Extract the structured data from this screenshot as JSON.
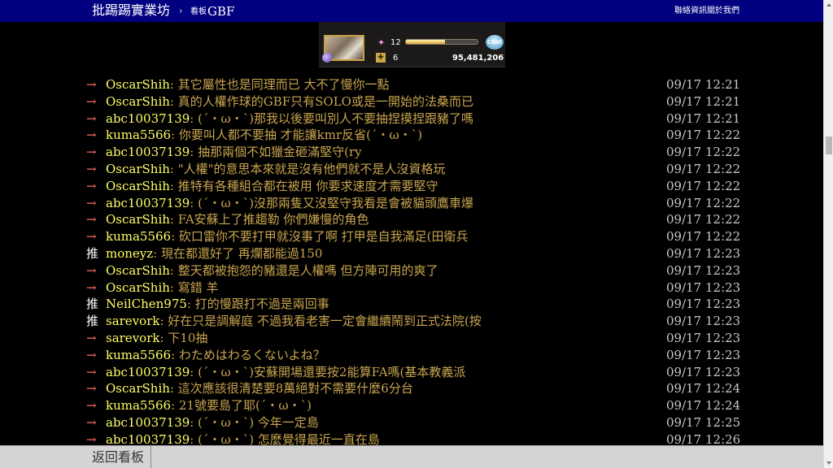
{
  "header": {
    "site_title": "批踢踢實業坊",
    "breadcrumb_sep": "›",
    "board_label": "看板",
    "board_name": "GBF",
    "links": [
      "聯絡資訊",
      "關於我們"
    ]
  },
  "game_image": {
    "stat1": "12",
    "stat2": "6",
    "bar_fill": 0.55,
    "chat": "Chat",
    "money": "95,481,206"
  },
  "pushes": [
    {
      "tag": "→",
      "user": "OscarShih",
      "content": ": 其它屬性也是同理而已 大不了慢你一點",
      "time": "09/17 12:21"
    },
    {
      "tag": "→",
      "user": "OscarShih",
      "content": ": 真的人權作球的GBF只有SOLO或是一開始的法桑而已",
      "time": "09/17 12:21"
    },
    {
      "tag": "→",
      "user": "abc10037139",
      "content": ": (ˊ・ω・ˋ)那我以後要叫別人不要抽捏摸捏跟豬了嗎",
      "time": "09/17 12:21"
    },
    {
      "tag": "→",
      "user": "kuma5566",
      "content": ": 你要叫人都不要抽 才能讓kmr反省(ˊ・ω・ˋ)",
      "time": "09/17 12:22"
    },
    {
      "tag": "→",
      "user": "abc10037139",
      "content": ": 抽那兩個不如獵金砸滿堅守(ry",
      "time": "09/17 12:22"
    },
    {
      "tag": "→",
      "user": "OscarShih",
      "content": ": \"人權\"的意思本來就是沒有他們就不是人沒資格玩",
      "time": "09/17 12:22"
    },
    {
      "tag": "→",
      "user": "OscarShih",
      "content": ": 推特有各種組合都在被用 你要求速度才需要堅守",
      "time": "09/17 12:22"
    },
    {
      "tag": "→",
      "user": "abc10037139",
      "content": ": (ˊ・ω・ˋ)沒那兩隻又沒堅守我看是會被貓頭鷹車爆",
      "time": "09/17 12:22"
    },
    {
      "tag": "→",
      "user": "OscarShih",
      "content": ": FA安蘇上了推趨勒 你們嫌慢的角色",
      "time": "09/17 12:22"
    },
    {
      "tag": "→",
      "user": "kuma5566",
      "content": ": 砍口雷你不要打甲就沒事了啊 打甲是自我滿足(田衛兵",
      "time": "09/17 12:22"
    },
    {
      "tag": "推",
      "user": "moneyz",
      "content": ": 現在都還好了 再爛都能過150",
      "time": "09/17 12:23"
    },
    {
      "tag": "→",
      "user": "OscarShih",
      "content": ": 整天都被抱怨的豬還是人權嗎 但方陣可用的爽了",
      "time": "09/17 12:23"
    },
    {
      "tag": "→",
      "user": "OscarShih",
      "content": ":  寫錯 羊",
      "time": "09/17 12:23"
    },
    {
      "tag": "推",
      "user": "NeilChen975",
      "content": ": 打的慢跟打不過是兩回事",
      "time": "09/17 12:23"
    },
    {
      "tag": "推",
      "user": "sarevork",
      "content": ": 好在只是調解庭 不過我看老害一定會繼續鬧到正式法院(按",
      "time": "09/17 12:23"
    },
    {
      "tag": "→",
      "user": "sarevork",
      "content": ": 下10抽",
      "time": "09/17 12:23"
    },
    {
      "tag": "→",
      "user": "kuma5566",
      "content": ": わためはわるくないよね？",
      "time": "09/17 12:23"
    },
    {
      "tag": "→",
      "user": "abc10037139",
      "content": ": (ˊ・ω・ˋ)安蘇開場還要按2能算FA嗎(基本教義派",
      "time": "09/17 12:23"
    },
    {
      "tag": "→",
      "user": "OscarShih",
      "content": ": 這次應該很清楚要8萬絕對不需要什麼6分台",
      "time": "09/17 12:24"
    },
    {
      "tag": "→",
      "user": "kuma5566",
      "content": ": 21號要島了耶(ˊ・ω・ˋ)",
      "time": "09/17 12:24"
    },
    {
      "tag": "→",
      "user": "abc10037139",
      "content": ": (ˊ・ω・ˋ) 今年一定島",
      "time": "09/17 12:25"
    },
    {
      "tag": "→",
      "user": "abc10037139",
      "content": ": (ˊ・ω・ˋ) 怎麼覺得最近一直在島",
      "time": "09/17 12:26"
    }
  ],
  "footer": {
    "back_label": "返回看板"
  },
  "colors": {
    "header_bg": "#000080",
    "user": "#ffff66",
    "content": "#c8a44e",
    "arrow": "#ff6b6b"
  }
}
